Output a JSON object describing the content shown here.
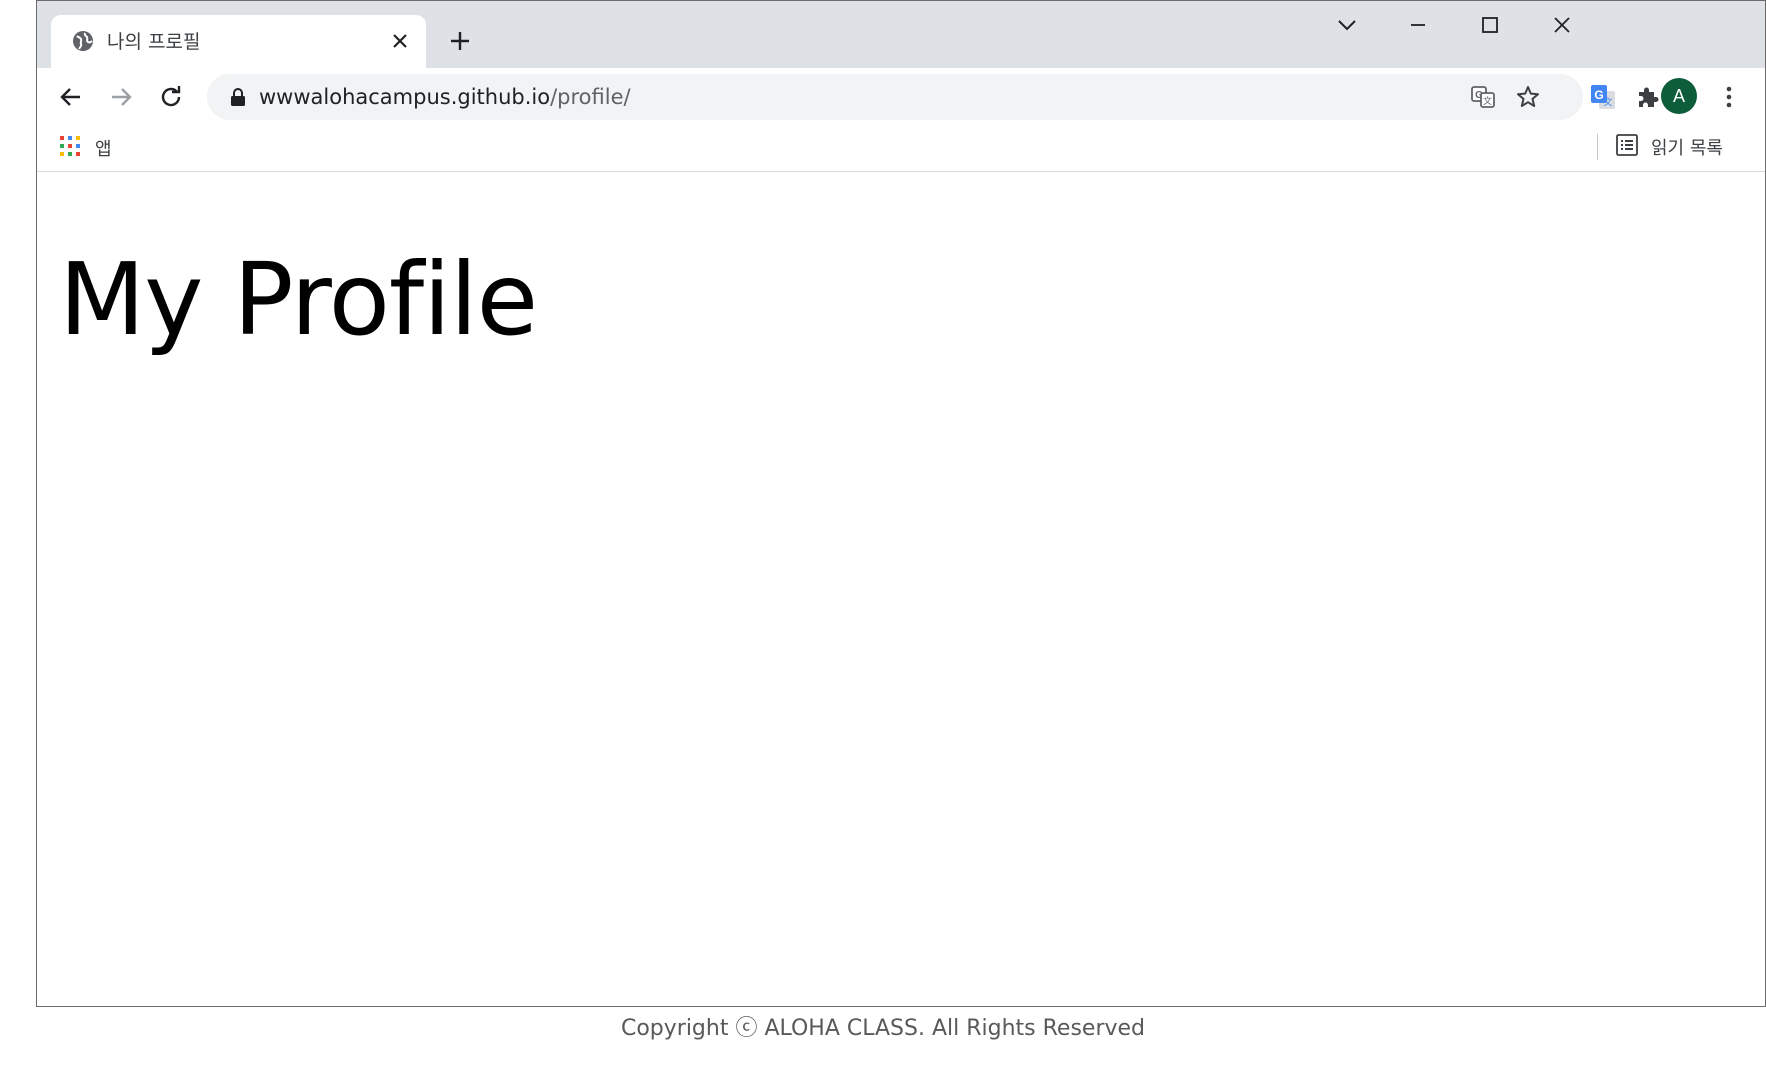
{
  "tab": {
    "title": "나의 프로필"
  },
  "address_bar": {
    "host": "wwwalohacampus.github.io",
    "path": "/profile/"
  },
  "bookmarks": {
    "apps_label": "앱",
    "reading_list_label": "읽기 목록"
  },
  "avatar": {
    "initial": "A",
    "color": "#0d5c3a"
  },
  "page": {
    "heading": "My Profile"
  },
  "footer": {
    "text": "Copyright ⓒ ALOHA CLASS. All Rights Reserved"
  },
  "icons": {
    "tab_favicon": "globe-icon",
    "tab_close": "close-icon",
    "new_tab": "plus-icon",
    "tab_search": "chevron-down-icon",
    "minimize": "minimize-icon",
    "maximize": "maximize-icon",
    "close_window": "close-icon",
    "back": "back-arrow-icon",
    "forward": "forward-arrow-icon",
    "reload": "reload-icon",
    "lock": "lock-icon",
    "translate": "translate-icon",
    "bookmark_star": "star-icon",
    "google_translate_ext": "google-translate-icon",
    "extensions": "puzzle-icon",
    "menu": "kebab-menu-icon",
    "apps": "apps-grid-icon",
    "reading_list": "reading-list-icon"
  }
}
